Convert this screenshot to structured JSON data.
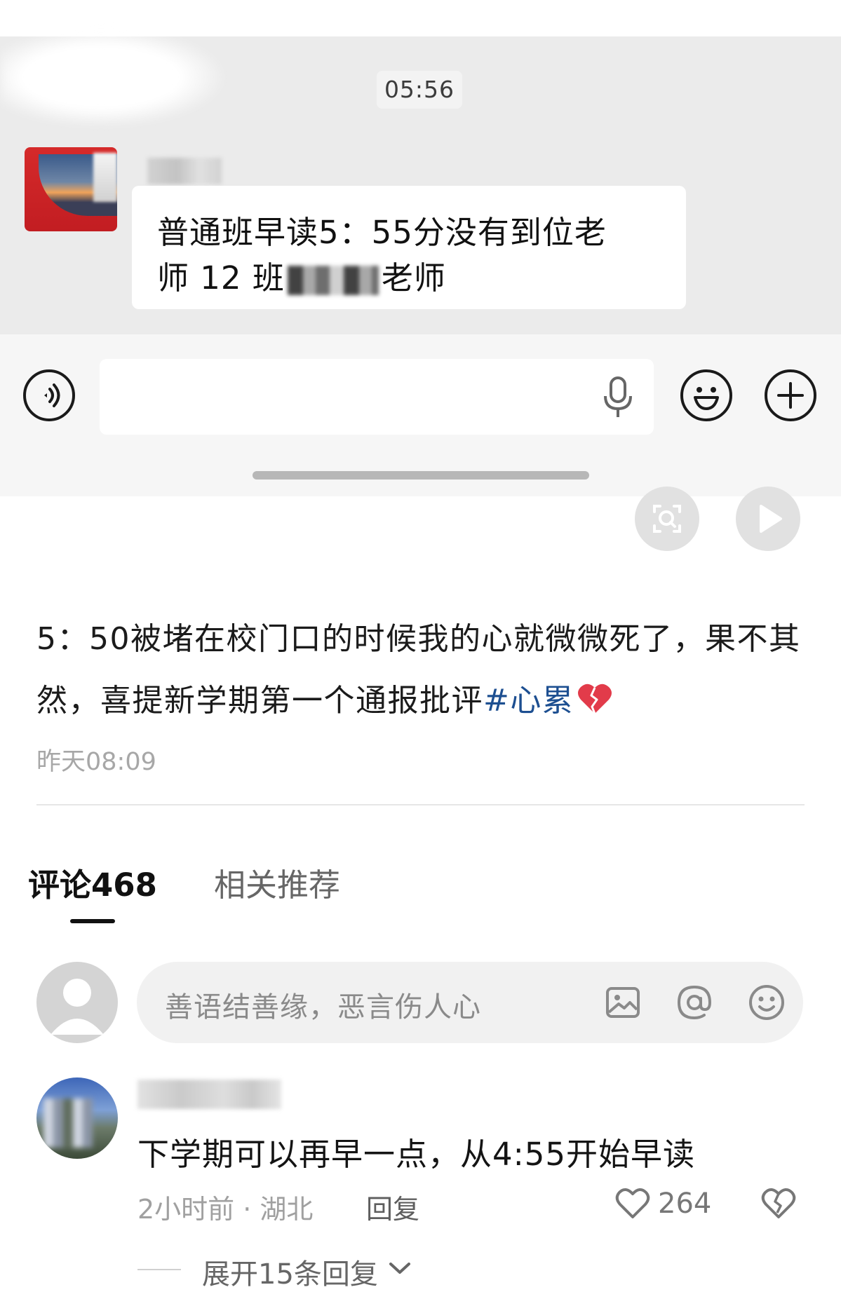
{
  "chat_screenshot": {
    "time": "05:56",
    "message_line1": "普通班早读5：55分没有到位老",
    "message_line2_prefix": "师 12 班",
    "message_line2_suffix": "老师"
  },
  "post": {
    "text": "5：50被堵在校门口的时候我的心就微微死了，果不其然，喜提新学期第一个通报批评",
    "hashtag": "#心累",
    "timestamp": "昨天08:09"
  },
  "tabs": {
    "comments": "评论468",
    "related": "相关推荐"
  },
  "comment_input": {
    "placeholder": "善语结善缘，恶言伤人心"
  },
  "comments": [
    {
      "text": "下学期可以再早一点，从4:55开始早读",
      "meta": "2小时前 · 湖北",
      "reply_label": "回复",
      "likes": "264",
      "expand_label": "展开15条回复"
    }
  ],
  "colors": {
    "hashtag": "#1d4f91",
    "chat_background": "#ebebeb",
    "muted_text": "#a7a7a7"
  }
}
